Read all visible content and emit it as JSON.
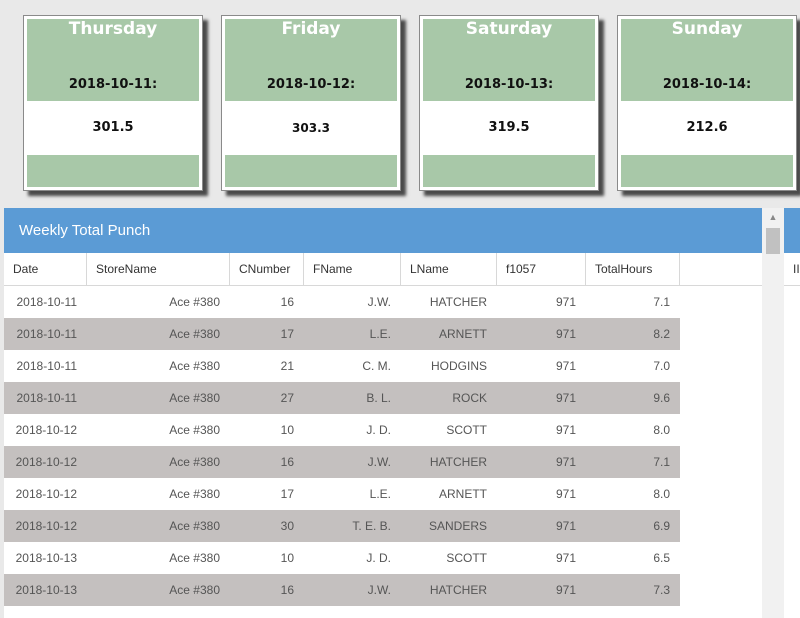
{
  "cards": [
    {
      "day": "Thursday",
      "date": "2018-10-11:",
      "value": "301.5"
    },
    {
      "day": "Friday",
      "date": "2018-10-12:",
      "value": "303.3"
    },
    {
      "day": "Saturday",
      "date": "2018-10-13:",
      "value": "319.5"
    },
    {
      "day": "Sunday",
      "date": "2018-10-14:",
      "value": "212.6"
    }
  ],
  "panel": {
    "title": "Weekly Total Punch",
    "columns": [
      "Date",
      "StoreName",
      "CNumber",
      "FName",
      "LName",
      "f1057",
      "TotalHours"
    ],
    "rows": [
      [
        "2018-10-11",
        "Ace #380",
        "16",
        "J.W.",
        "HATCHER",
        "971",
        "7.1"
      ],
      [
        "2018-10-11",
        "Ace #380",
        "17",
        "L.E.",
        "ARNETT",
        "971",
        "8.2"
      ],
      [
        "2018-10-11",
        "Ace #380",
        "21",
        "C. M.",
        "HODGINS",
        "971",
        "7.0"
      ],
      [
        "2018-10-11",
        "Ace #380",
        "27",
        "B. L.",
        "ROCK",
        "971",
        "9.6"
      ],
      [
        "2018-10-12",
        "Ace #380",
        "10",
        "J. D.",
        "SCOTT",
        "971",
        "8.0"
      ],
      [
        "2018-10-12",
        "Ace #380",
        "16",
        "J.W.",
        "HATCHER",
        "971",
        "7.1"
      ],
      [
        "2018-10-12",
        "Ace #380",
        "17",
        "L.E.",
        "ARNETT",
        "971",
        "8.0"
      ],
      [
        "2018-10-12",
        "Ace #380",
        "30",
        "T. E. B.",
        "SANDERS",
        "971",
        "6.9"
      ],
      [
        "2018-10-13",
        "Ace #380",
        "10",
        "J. D.",
        "SCOTT",
        "971",
        "6.5"
      ],
      [
        "2018-10-13",
        "Ace #380",
        "16",
        "J.W.",
        "HATCHER",
        "971",
        "7.3"
      ]
    ]
  },
  "side_panel": {
    "header": "II"
  },
  "colors": {
    "card_green": "#a8c8a8",
    "panel_blue": "#5b9bd5",
    "alt_row": "#c4c0bf"
  }
}
